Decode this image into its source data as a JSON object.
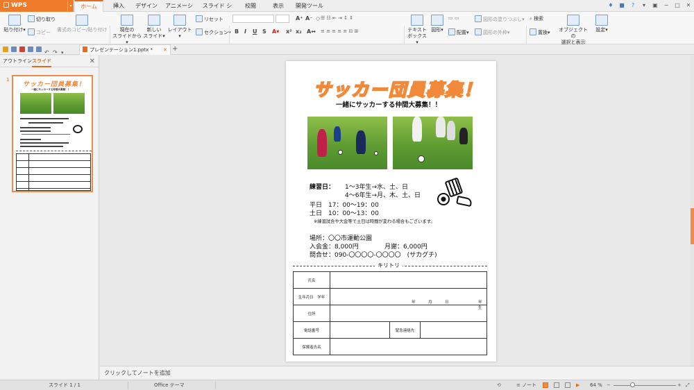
{
  "app": {
    "name": "WPS Presentation"
  },
  "tabs": [
    {
      "label": "ホーム",
      "active": true
    },
    {
      "label": "挿入"
    },
    {
      "label": "デザイン"
    },
    {
      "label": "アニメーション"
    },
    {
      "label": "スライド ショー"
    },
    {
      "label": "校閲"
    },
    {
      "label": "表示"
    },
    {
      "label": "開発ツール"
    }
  ],
  "ribbon": {
    "paste": "貼り付け",
    "cut": "切り取り",
    "copy": "コピー",
    "format_copy": "書式のコピー/貼り付け",
    "from_current_1": "現在の",
    "from_current_2": "スライドから",
    "new_slide_1": "新しい",
    "new_slide_2": "スライド",
    "layout": "レイアウト",
    "reset": "リセット",
    "section": "セクション",
    "textbox_1": "テキスト",
    "textbox_2": "ボックス",
    "shape": "図形",
    "arrange": "配置",
    "fill": "図形の塗りつぶし",
    "outline": "図形の外枠",
    "find": "検索",
    "replace": "置換",
    "select_1": "オブジェクトの",
    "select_2": "選択と表示",
    "settings": "設定"
  },
  "document": {
    "tab": "プレゼンテーション1.pptx *"
  },
  "left_panel": {
    "outline": "アウトライン",
    "slides": "スライド",
    "slide_number": "1"
  },
  "slide": {
    "title": "サッカー団員募集！",
    "subtitle": "一緒にサッカーする仲間大募集！！",
    "practice_label": "練習日：",
    "practice_1": "1～3年生→水、土、日",
    "practice_2": "4～6年生→月、木、土、日",
    "weekday": "平日　17：00～19：00",
    "weekend": "土日　10：00～13：00",
    "note": "※練習試合や大会等で土日は時間が変わる場合もございます。",
    "place": "場所：〇〇市運動公園",
    "entry_fee": "入会金：8,000円",
    "monthly_fee": "月謝：6,000円",
    "contact": "問合せ：090-〇〇〇〇-〇〇〇〇　(サカグチ)",
    "cut_line": "キリトリ",
    "form": {
      "name": "氏名",
      "birth_grade": "生年月日　学年",
      "year": "年",
      "month": "月",
      "day": "日",
      "grade": "年生",
      "address": "住所",
      "phone": "電話番号",
      "emergency": "緊急連絡先",
      "guardian": "保護者氏名"
    }
  },
  "notes": {
    "placeholder": "クリックしてノートを追加"
  },
  "status": {
    "slide": "スライド 1 / 1",
    "theme": "Office テーマ",
    "notes": "ノート",
    "zoom": "64 %"
  },
  "colors": {
    "accent": "#e86b17",
    "title_orange": "#f08a3a"
  }
}
